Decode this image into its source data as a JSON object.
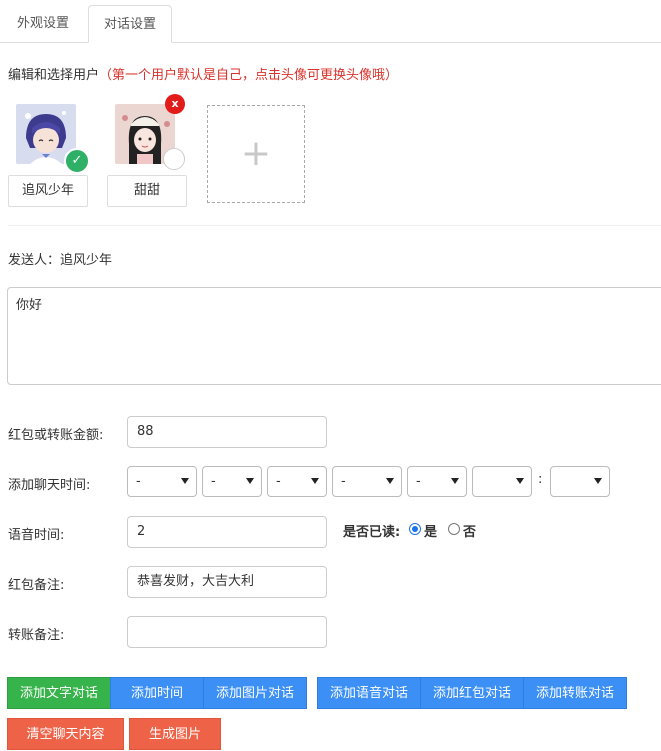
{
  "tabs": [
    {
      "label": "外观设置",
      "active": false
    },
    {
      "label": "对话设置",
      "active": true
    }
  ],
  "users_section": {
    "title": "编辑和选择用户",
    "hint": "（第一个用户默认是自己，点击头像可更换头像哦）",
    "users": [
      {
        "name": "追风少年",
        "selected": true
      },
      {
        "name": "甜甜",
        "selected": false
      }
    ],
    "remove_label": "x",
    "add_label": "+"
  },
  "sender": {
    "label": "发送人：",
    "name": "追风少年"
  },
  "message": {
    "value": "你好"
  },
  "form": {
    "amount_label": "红包或转账金额:",
    "amount_value": "88",
    "time_label": "添加聊天时间:",
    "time_selects": [
      "-",
      "-",
      "-",
      "-",
      "-",
      "",
      ""
    ],
    "time_separator": ":",
    "voice_label": "语音时间:",
    "voice_value": "2",
    "read_label": "是否已读:",
    "read_options": [
      "是",
      "否"
    ],
    "read_selected": "是",
    "redpacket_note_label": "红包备注:",
    "redpacket_note_value": "恭喜发财，大吉大利",
    "transfer_note_label": "转账备注:",
    "transfer_note_value": ""
  },
  "buttons": {
    "add_text": "添加文字对话",
    "add_time": "添加时间",
    "add_image": "添加图片对话",
    "add_voice": "添加语音对话",
    "add_redpacket": "添加红包对话",
    "add_transfer": "添加转账对话",
    "clear": "清空聊天内容",
    "generate": "生成图片"
  },
  "colors": {
    "accent_green": "#36b34a",
    "accent_blue": "#3b8ff5",
    "accent_orange": "#ee6248",
    "hint_red": "#d9322b",
    "check_green": "#2fb067",
    "remove_red": "#e21b1b"
  }
}
